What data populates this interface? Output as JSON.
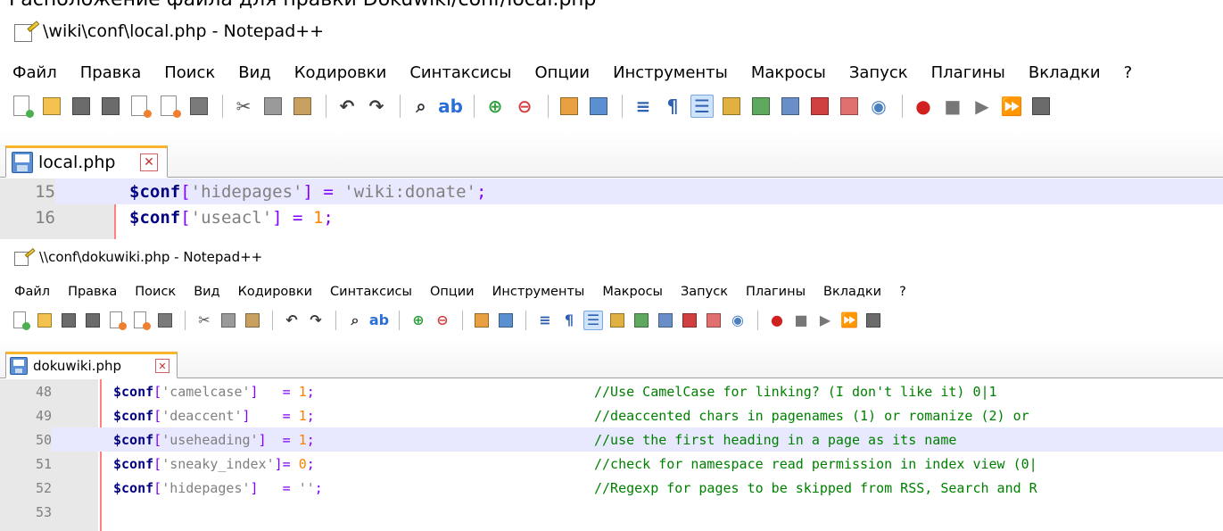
{
  "caption": "Расположение файла для правки Dokuwiki/conf/local.php",
  "menu": [
    "Файл",
    "Правка",
    "Поиск",
    "Вид",
    "Кодировки",
    "Синтаксисы",
    "Опции",
    "Инструменты",
    "Макросы",
    "Запуск",
    "Плагины",
    "Вкладки",
    "?"
  ],
  "window1": {
    "title": "\\wiki\\conf\\local.php - Notepad++",
    "tab_label": "local.php",
    "close_glyph": "✕",
    "lines": [
      {
        "num": "15",
        "var": "$conf",
        "op1": "[",
        "key": "'hidepages'",
        "op2": "] = ",
        "val": "'wiki:donate'",
        "valtype": "str",
        "end": ";",
        "current": true
      },
      {
        "num": "16",
        "var": "$conf",
        "op1": "[",
        "key": "'useacl'",
        "op2": "] = ",
        "val": "1",
        "valtype": "num",
        "end": ";",
        "current": false
      }
    ]
  },
  "window2": {
    "title": "\\\\conf\\dokuwiki.php - Notepad++",
    "tab_label": "dokuwiki.php",
    "close_glyph": "✕",
    "lines": [
      {
        "num": "48",
        "var": "$conf",
        "op1": "[",
        "key": "'camelcase'",
        "op2": "]   = ",
        "val": "1",
        "valtype": "num",
        "end": ";",
        "comment": "//Use CamelCase for linking? (I don't like it) 0|1",
        "current": false
      },
      {
        "num": "49",
        "var": "$conf",
        "op1": "[",
        "key": "'deaccent'",
        "op2": "]    = ",
        "val": "1",
        "valtype": "num",
        "end": ";",
        "comment": "//deaccented chars in pagenames (1) or romanize (2) or",
        "current": false
      },
      {
        "num": "50",
        "var": "$conf",
        "op1": "[",
        "key": "'useheading'",
        "op2": "]  = ",
        "val": "1",
        "valtype": "num",
        "end": ";",
        "comment": "//use the first heading in a page as its name",
        "current": true
      },
      {
        "num": "51",
        "var": "$conf",
        "op1": "[",
        "key": "'sneaky_index'",
        "op2": "]= ",
        "val": "0",
        "valtype": "num",
        "end": ";",
        "comment": "//check for namespace read permission in index view (0|",
        "current": false
      },
      {
        "num": "52",
        "var": "$conf",
        "op1": "[",
        "key": "'hidepages'",
        "op2": "]   = ",
        "val": "''",
        "valtype": "str",
        "end": ";",
        "comment": "//Regexp for pages to be skipped from RSS, Search and R",
        "current": false
      },
      {
        "num": "53",
        "var": "",
        "op1": "",
        "key": "",
        "op2": "",
        "val": "",
        "valtype": "str",
        "end": "",
        "comment": "",
        "current": false
      }
    ]
  },
  "toolbar": [
    {
      "name": "new-file-icon",
      "kind": "doc",
      "color": "#4caf50"
    },
    {
      "name": "open-file-icon",
      "kind": "fill",
      "color": "#f2c14e"
    },
    {
      "name": "save-icon",
      "kind": "fill",
      "color": "#6b6b6b"
    },
    {
      "name": "save-all-icon",
      "kind": "fill",
      "color": "#6b6b6b"
    },
    {
      "name": "close-file-icon",
      "kind": "doc",
      "color": "#f08030"
    },
    {
      "name": "close-all-icon",
      "kind": "doc",
      "color": "#f08030"
    },
    {
      "name": "print-icon",
      "kind": "fill",
      "color": "#7a7a7a"
    },
    {
      "name": "sep"
    },
    {
      "name": "cut-icon",
      "kind": "glyph",
      "glyph": "✂",
      "color": "#555555"
    },
    {
      "name": "copy-icon",
      "kind": "fill",
      "color": "#9a9a9a"
    },
    {
      "name": "paste-icon",
      "kind": "fill",
      "color": "#c8a060"
    },
    {
      "name": "sep"
    },
    {
      "name": "undo-icon",
      "kind": "glyph",
      "glyph": "↶",
      "color": "#3a3a3a"
    },
    {
      "name": "redo-icon",
      "kind": "glyph",
      "glyph": "↷",
      "color": "#3a3a3a"
    },
    {
      "name": "sep"
    },
    {
      "name": "find-icon",
      "kind": "glyph",
      "glyph": "⌕",
      "color": "#333333"
    },
    {
      "name": "replace-icon",
      "kind": "glyph",
      "glyph": "ab",
      "color": "#2a6fd6"
    },
    {
      "name": "sep"
    },
    {
      "name": "zoom-in-icon",
      "kind": "glyph",
      "glyph": "⊕",
      "color": "#2e9e3e"
    },
    {
      "name": "zoom-out-icon",
      "kind": "glyph",
      "glyph": "⊖",
      "color": "#d04040"
    },
    {
      "name": "sep"
    },
    {
      "name": "sync-vertical-icon",
      "kind": "fill",
      "color": "#e8a040"
    },
    {
      "name": "sync-horizontal-icon",
      "kind": "fill",
      "color": "#5a8fd0"
    },
    {
      "name": "sep"
    },
    {
      "name": "word-wrap-icon",
      "kind": "glyph",
      "glyph": "≡",
      "color": "#3060b0"
    },
    {
      "name": "show-all-chars-icon",
      "kind": "glyph",
      "glyph": "¶",
      "color": "#3060b0"
    },
    {
      "name": "indent-guide-icon",
      "kind": "glyph",
      "glyph": "☰",
      "color": "#3060b0",
      "active": true
    },
    {
      "name": "user-language-icon",
      "kind": "fill",
      "color": "#e0b040"
    },
    {
      "name": "doc-map-icon",
      "kind": "fill",
      "color": "#5fa85f"
    },
    {
      "name": "function-list-icon",
      "kind": "fill",
      "color": "#6a8fc8"
    },
    {
      "name": "folder-as-workspace-icon",
      "kind": "fill",
      "color": "#d04040"
    },
    {
      "name": "folder-icon",
      "kind": "fill",
      "color": "#e07070"
    },
    {
      "name": "monitoring-icon",
      "kind": "glyph",
      "glyph": "◉",
      "color": "#4a7fc0"
    },
    {
      "name": "sep"
    },
    {
      "name": "record-macro-icon",
      "kind": "glyph",
      "glyph": "●",
      "color": "#d02020"
    },
    {
      "name": "stop-macro-icon",
      "kind": "glyph",
      "glyph": "■",
      "color": "#777777"
    },
    {
      "name": "play-macro-icon",
      "kind": "glyph",
      "glyph": "▶",
      "color": "#777777"
    },
    {
      "name": "run-macro-multiple-icon",
      "kind": "glyph",
      "glyph": "⏩",
      "color": "#4060c0"
    },
    {
      "name": "save-macro-icon",
      "kind": "fill",
      "color": "#6b6b6b"
    }
  ]
}
